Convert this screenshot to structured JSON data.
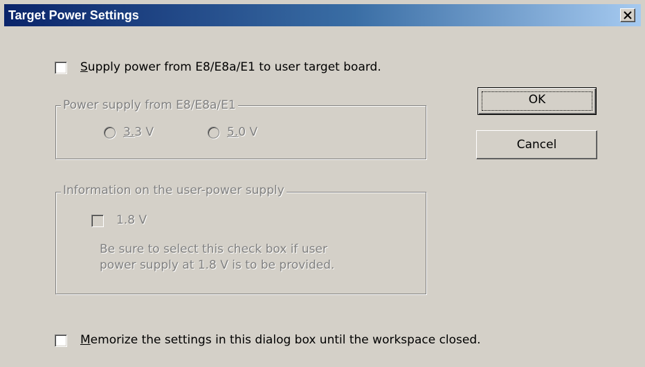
{
  "window": {
    "title": "Target Power Settings",
    "close_icon": "close-icon"
  },
  "supply_power": {
    "label": "Supply power from E8/E8a/E1 to user target board.",
    "checked": false
  },
  "power_group": {
    "legend": "Power supply from E8/E8a/E1",
    "options": [
      {
        "label": "3.3 V",
        "selected": false
      },
      {
        "label": "5.0 V",
        "selected": false
      }
    ]
  },
  "info_group": {
    "legend": "Information on the user-power supply",
    "checkbox_label": "1.8 V",
    "note_line1": "Be sure to select this check box if user",
    "note_line2": "power supply at 1.8 V is to be provided."
  },
  "memorize": {
    "label": "Memorize the settings in this dialog box until the workspace closed.",
    "checked": false
  },
  "buttons": {
    "ok": "OK",
    "cancel": "Cancel"
  }
}
